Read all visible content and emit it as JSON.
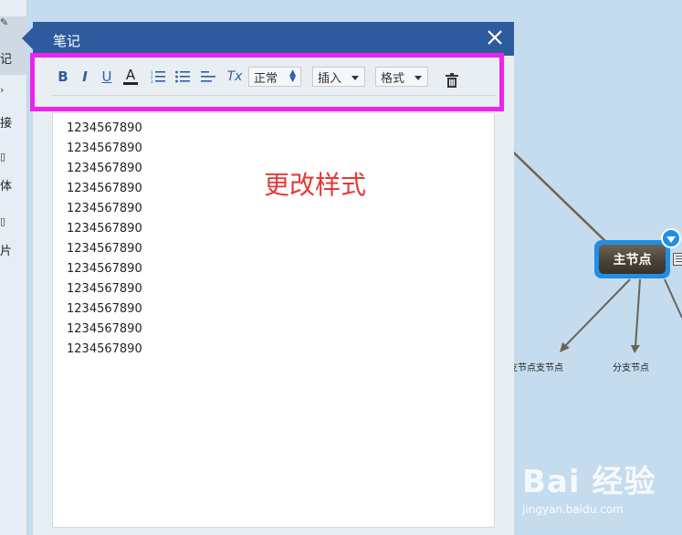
{
  "sidebar": {
    "items": [
      {
        "icon": "note-icon",
        "label": "记"
      },
      {
        "icon": "link-icon",
        "label": "接"
      },
      {
        "icon": "node-icon",
        "label": "体"
      },
      {
        "icon": "image-icon",
        "label": "片"
      }
    ]
  },
  "note_panel": {
    "title": "笔记",
    "toolbar": {
      "bold": "B",
      "italic": "I",
      "underline": "U",
      "font_color": "A",
      "clear_format": "Tx",
      "heading_select": "正常",
      "insert_select": "插入",
      "format_select": "格式"
    },
    "lines": [
      "1234567890",
      "1234567890",
      "1234567890",
      "1234567890",
      "1234567890",
      "1234567890",
      "1234567890",
      "1234567890",
      "1234567890",
      "1234567890",
      "1234567890",
      "1234567890"
    ],
    "annotation": "更改样式"
  },
  "mindmap": {
    "main_node": "主节点",
    "sub_nodes": [
      "支节点支节点",
      "分支节点"
    ]
  },
  "watermark": {
    "main": "Bai 经验",
    "sub": "jingyan.baidu.com"
  },
  "colors": {
    "header": "#2d5b9d",
    "highlight": "#ee22ee",
    "annotation": "#e53935",
    "canvas": "#c4dcee",
    "node_border": "#1f8fe6"
  }
}
